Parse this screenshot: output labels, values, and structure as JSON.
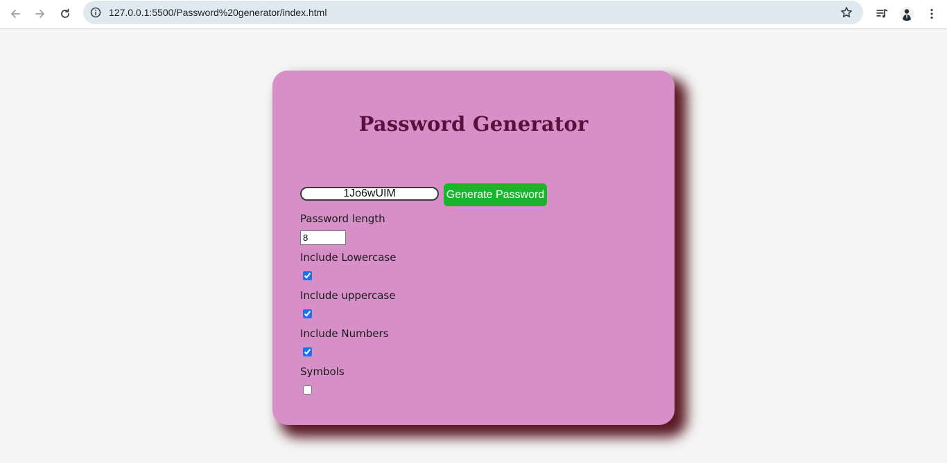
{
  "browser": {
    "url": "127.0.0.1:5500/Password%20generator/index.html",
    "icons": {
      "back": "arrow-left-icon",
      "forward": "arrow-right-icon",
      "reload": "reload-icon",
      "site_info": "info-icon",
      "bookmark": "star-icon",
      "media": "media-queue-icon",
      "profile": "avatar",
      "menu": "kebab-menu-icon"
    }
  },
  "app": {
    "title": "Password Generator",
    "password_output": "1Jo6wUIM",
    "generate_button_label": "Generate Password",
    "length_label": "Password length",
    "length_value": "8",
    "options": [
      {
        "label": "Include Lowercase",
        "checked": true
      },
      {
        "label": "Include uppercase",
        "checked": true
      },
      {
        "label": "Include Numbers",
        "checked": true
      },
      {
        "label": "Symbols",
        "checked": false
      }
    ]
  },
  "colors": {
    "page_background": "#f5f5f5",
    "card_background": "#d68fc7",
    "card_shadow": "#5a1a24",
    "title_color": "#5b0f3d",
    "button_background": "#19b52e",
    "button_text": "#ffffff"
  }
}
